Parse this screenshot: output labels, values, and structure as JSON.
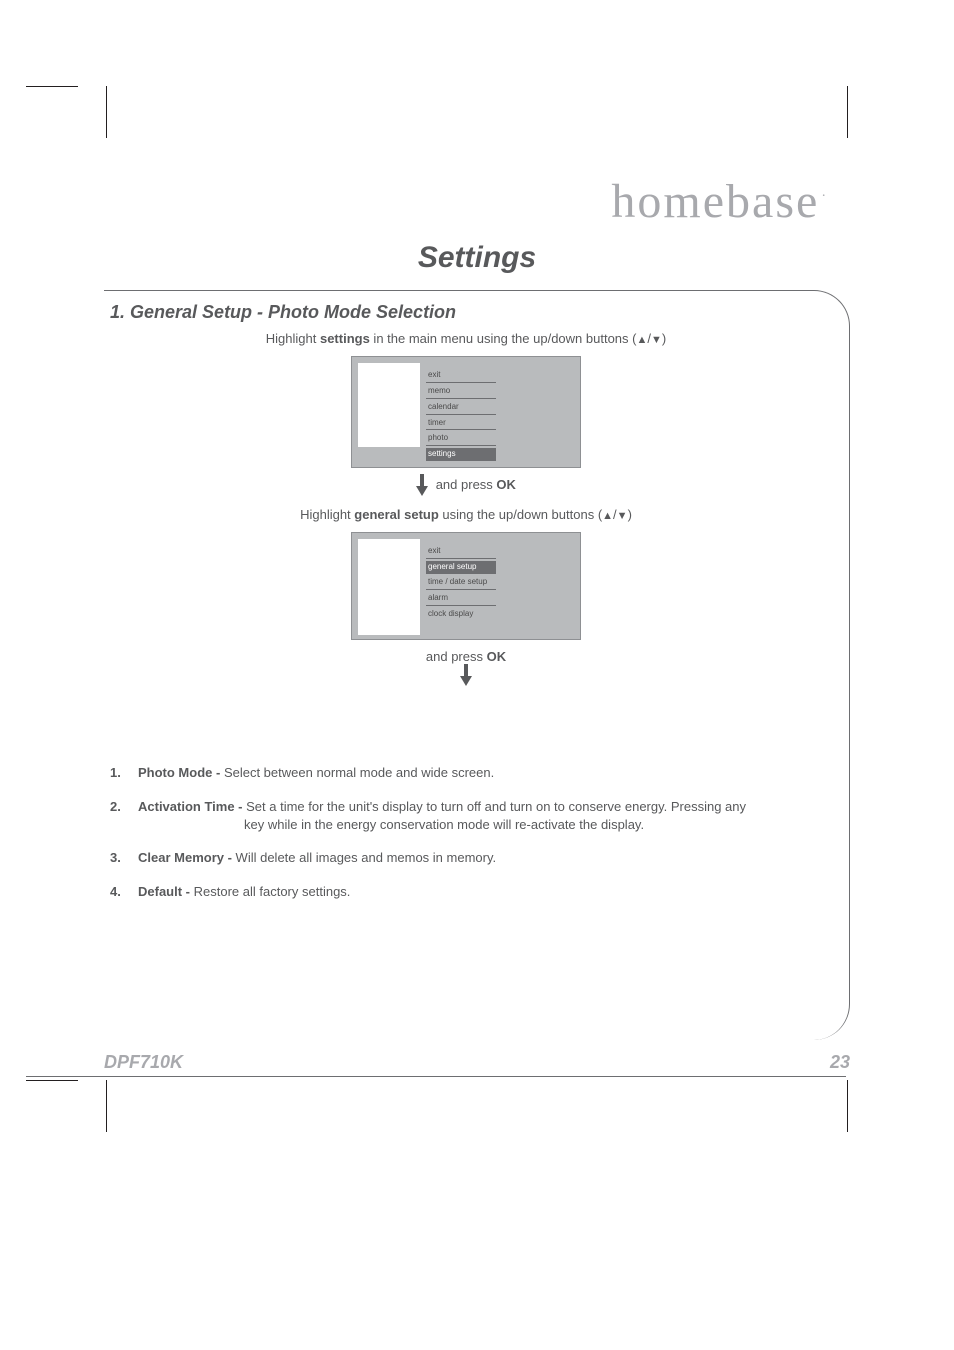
{
  "brand": {
    "part1": "home",
    "part2": "base",
    "mark": "·"
  },
  "page_title": "Settings",
  "section_heading": "1. General Setup - Photo Mode Selection",
  "instruction1": {
    "pre": "Highlight ",
    "bold": "settings",
    "post": " in the main menu using the up/down buttons (",
    "arr_up": "▲",
    "sep": "/",
    "arr_dn": "▼",
    "close": ")"
  },
  "menu1": {
    "items": [
      "exit",
      "memo",
      "calendar",
      "timer",
      "photo",
      "settings"
    ],
    "selected_index": 5
  },
  "press_ok": "and press OK",
  "instruction2": {
    "pre": "Highlight ",
    "bold": "general setup",
    "post": " using the up/down buttons (",
    "arr_up": "▲",
    "sep": "/",
    "arr_dn": "▼",
    "close": ")"
  },
  "menu2": {
    "items": [
      "exit",
      "general setup",
      "time / date setup",
      "alarm",
      "clock display"
    ],
    "selected_index": 1
  },
  "list": [
    {
      "n": "1.",
      "lead": "Photo Mode - ",
      "text": "Select between normal mode and wide screen.",
      "cont": ""
    },
    {
      "n": "2.",
      "lead": "Activation Time - ",
      "text": "Set a time for the unit's display to turn off and turn on to conserve energy. Pressing any",
      "cont": "key while in the energy conservation mode will re-activate the display."
    },
    {
      "n": "3.",
      "lead": "Clear Memory - ",
      "text": "Will delete all images and memos in memory.",
      "cont": ""
    },
    {
      "n": "4.",
      "lead": "Default - ",
      "text": "Restore all factory settings.",
      "cont": ""
    }
  ],
  "model": "DPF710K",
  "page_number": "23"
}
